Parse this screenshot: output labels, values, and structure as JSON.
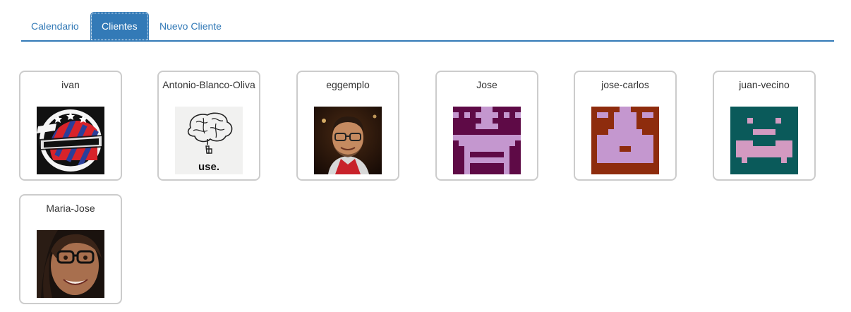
{
  "tabs": [
    {
      "label": "Calendario",
      "active": false
    },
    {
      "label": "Clientes",
      "active": true
    },
    {
      "label": "Nuevo Cliente",
      "active": false
    }
  ],
  "clients": [
    {
      "name": "ivan",
      "avatar": "barberia-logo-image"
    },
    {
      "name": "Antonio-Blanco-Oliva",
      "avatar": "brain-sketch-image",
      "avatar_caption": "use."
    },
    {
      "name": "eggemplo",
      "avatar": "man-with-glasses-photo"
    },
    {
      "name": "Jose",
      "avatar": "identicon-purple",
      "color": "#5e0a46",
      "fill": "#c497cf"
    },
    {
      "name": "jose-carlos",
      "avatar": "identicon-rust",
      "color": "#8e2c0d",
      "fill": "#c497cf"
    },
    {
      "name": "juan-vecino",
      "avatar": "identicon-teal",
      "color": "#0a5a5a",
      "fill": "#d39ac1"
    },
    {
      "name": "Maria-Jose",
      "avatar": "woman-with-glasses-photo"
    }
  ],
  "accent_color": "#337ab7"
}
